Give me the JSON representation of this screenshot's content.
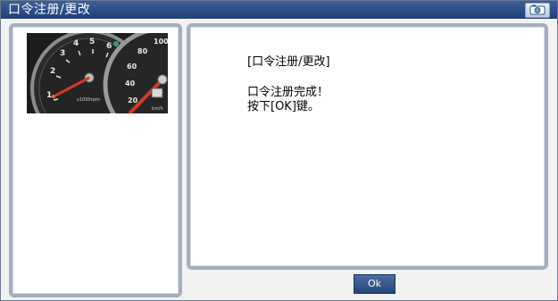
{
  "window": {
    "title": "口令注册/更改",
    "camera_icon": "camera-icon"
  },
  "image_panel": {
    "image": "speedometer-cluster-photo",
    "colors": {
      "dial": "#222222",
      "needle": "#d23a2a",
      "numbers": "#f2f2f2"
    }
  },
  "message": {
    "title": "[口令注册/更改]",
    "line1": "口令注册完成！",
    "line2": "按下[OK]键。"
  },
  "buttons": {
    "ok_label": "Ok"
  }
}
